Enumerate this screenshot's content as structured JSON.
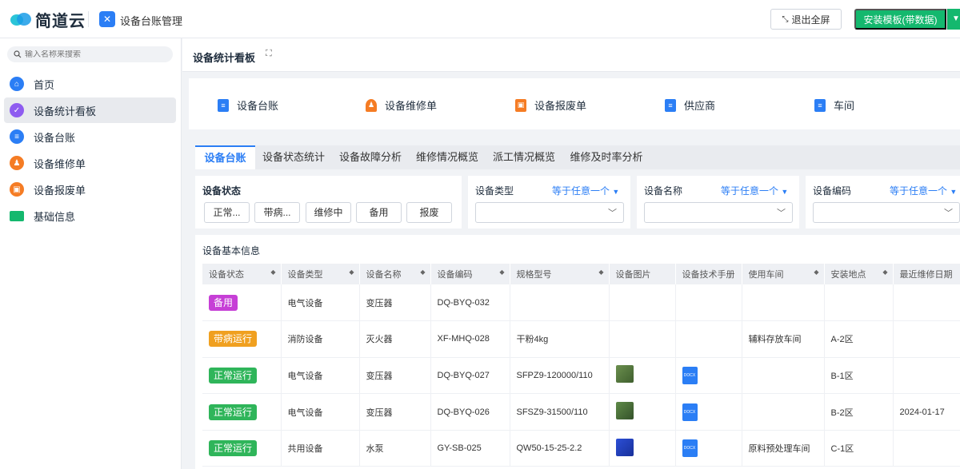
{
  "topbar": {
    "logo_text": "简道云",
    "app_title": "设备台账管理",
    "exit_label": "退出全屏",
    "install_label": "安装模板(带数据)"
  },
  "sidebar": {
    "search_placeholder": "输入名称来搜索",
    "items": [
      {
        "label": "首页",
        "icon": "home-icon",
        "color": "#2b7ef5"
      },
      {
        "label": "设备统计看板",
        "icon": "shield-icon",
        "color": "#8e5cf0",
        "active": true
      },
      {
        "label": "设备台账",
        "icon": "list-icon",
        "color": "#2b7ef5"
      },
      {
        "label": "设备维修单",
        "icon": "worker-icon",
        "color": "#f57c24"
      },
      {
        "label": "设备报废单",
        "icon": "scrap-icon",
        "color": "#f57c24"
      },
      {
        "label": "基础信息",
        "icon": "folder-icon",
        "color": "#14b86e"
      }
    ]
  },
  "page": {
    "title": "设备统计看板"
  },
  "quicklinks": [
    {
      "label": "设备台账",
      "color": "#2b7ef5"
    },
    {
      "label": "设备维修单",
      "color": "#f57c24"
    },
    {
      "label": "设备报废单",
      "color": "#f57c24"
    },
    {
      "label": "供应商",
      "color": "#2b7ef5"
    },
    {
      "label": "车间",
      "color": "#2b7ef5"
    }
  ],
  "tabs": [
    "设备台账",
    "设备状态统计",
    "设备故障分析",
    "维修情况概览",
    "派工情况概览",
    "维修及时率分析"
  ],
  "filters": {
    "status_label": "设备状态",
    "status_buttons": [
      "正常...",
      "带病...",
      "维修中",
      "备用",
      "报废"
    ],
    "type_label": "设备类型",
    "name_label": "设备名称",
    "code_label": "设备编码",
    "operator": "等于任意一个"
  },
  "table": {
    "title": "设备基本信息",
    "columns": [
      "设备状态",
      "设备类型",
      "设备名称",
      "设备编码",
      "规格型号",
      "设备图片",
      "设备技术手册",
      "使用车间",
      "安装地点",
      "最近维修日期"
    ],
    "rows": [
      {
        "status": "备用",
        "status_color": "#c63fd6",
        "type": "电气设备",
        "name": "变压器",
        "code": "DQ-BYQ-032",
        "spec": "",
        "image": "",
        "manual": "",
        "workshop": "",
        "location": "",
        "repair_date": ""
      },
      {
        "status": "带病运行",
        "status_color": "#f0a020",
        "type": "消防设备",
        "name": "灭火器",
        "code": "XF-MHQ-028",
        "spec": "干粉4kg",
        "image": "",
        "manual": "",
        "workshop": "辅料存放车间",
        "location": "A-2区",
        "repair_date": ""
      },
      {
        "status": "正常运行",
        "status_color": "#2fb55a",
        "type": "电气设备",
        "name": "变压器",
        "code": "DQ-BYQ-027",
        "spec": "SFPZ9-120000/110",
        "image": "transformer",
        "manual": "DOCX",
        "workshop": "",
        "location": "B-1区",
        "repair_date": ""
      },
      {
        "status": "正常运行",
        "status_color": "#2fb55a",
        "type": "电气设备",
        "name": "变压器",
        "code": "DQ-BYQ-026",
        "spec": "SFSZ9-31500/110",
        "image": "transformer",
        "manual": "DOCX",
        "workshop": "",
        "location": "B-2区",
        "repair_date": "2024-01-17"
      },
      {
        "status": "正常运行",
        "status_color": "#2fb55a",
        "type": "共用设备",
        "name": "水泵",
        "code": "GY-SB-025",
        "spec": "QW50-15-25-2.2",
        "image": "pump",
        "manual": "DOCX",
        "workshop": "原料预处理车间",
        "location": "C-1区",
        "repair_date": ""
      }
    ]
  }
}
